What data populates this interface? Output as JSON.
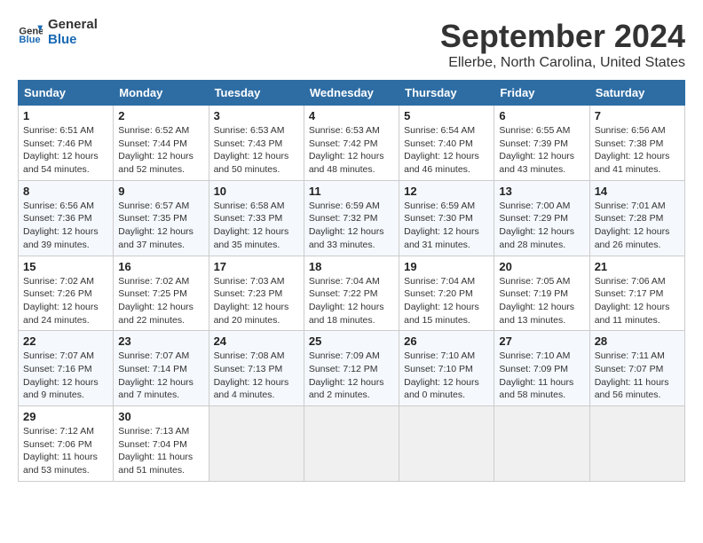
{
  "logo": {
    "line1": "General",
    "line2": "Blue"
  },
  "title": "September 2024",
  "location": "Ellerbe, North Carolina, United States",
  "days_of_week": [
    "Sunday",
    "Monday",
    "Tuesday",
    "Wednesday",
    "Thursday",
    "Friday",
    "Saturday"
  ],
  "weeks": [
    [
      {
        "day": "1",
        "sunrise": "6:51 AM",
        "sunset": "7:46 PM",
        "daylight": "12 hours and 54 minutes."
      },
      {
        "day": "2",
        "sunrise": "6:52 AM",
        "sunset": "7:44 PM",
        "daylight": "12 hours and 52 minutes."
      },
      {
        "day": "3",
        "sunrise": "6:53 AM",
        "sunset": "7:43 PM",
        "daylight": "12 hours and 50 minutes."
      },
      {
        "day": "4",
        "sunrise": "6:53 AM",
        "sunset": "7:42 PM",
        "daylight": "12 hours and 48 minutes."
      },
      {
        "day": "5",
        "sunrise": "6:54 AM",
        "sunset": "7:40 PM",
        "daylight": "12 hours and 46 minutes."
      },
      {
        "day": "6",
        "sunrise": "6:55 AM",
        "sunset": "7:39 PM",
        "daylight": "12 hours and 43 minutes."
      },
      {
        "day": "7",
        "sunrise": "6:56 AM",
        "sunset": "7:38 PM",
        "daylight": "12 hours and 41 minutes."
      }
    ],
    [
      {
        "day": "8",
        "sunrise": "6:56 AM",
        "sunset": "7:36 PM",
        "daylight": "12 hours and 39 minutes."
      },
      {
        "day": "9",
        "sunrise": "6:57 AM",
        "sunset": "7:35 PM",
        "daylight": "12 hours and 37 minutes."
      },
      {
        "day": "10",
        "sunrise": "6:58 AM",
        "sunset": "7:33 PM",
        "daylight": "12 hours and 35 minutes."
      },
      {
        "day": "11",
        "sunrise": "6:59 AM",
        "sunset": "7:32 PM",
        "daylight": "12 hours and 33 minutes."
      },
      {
        "day": "12",
        "sunrise": "6:59 AM",
        "sunset": "7:30 PM",
        "daylight": "12 hours and 31 minutes."
      },
      {
        "day": "13",
        "sunrise": "7:00 AM",
        "sunset": "7:29 PM",
        "daylight": "12 hours and 28 minutes."
      },
      {
        "day": "14",
        "sunrise": "7:01 AM",
        "sunset": "7:28 PM",
        "daylight": "12 hours and 26 minutes."
      }
    ],
    [
      {
        "day": "15",
        "sunrise": "7:02 AM",
        "sunset": "7:26 PM",
        "daylight": "12 hours and 24 minutes."
      },
      {
        "day": "16",
        "sunrise": "7:02 AM",
        "sunset": "7:25 PM",
        "daylight": "12 hours and 22 minutes."
      },
      {
        "day": "17",
        "sunrise": "7:03 AM",
        "sunset": "7:23 PM",
        "daylight": "12 hours and 20 minutes."
      },
      {
        "day": "18",
        "sunrise": "7:04 AM",
        "sunset": "7:22 PM",
        "daylight": "12 hours and 18 minutes."
      },
      {
        "day": "19",
        "sunrise": "7:04 AM",
        "sunset": "7:20 PM",
        "daylight": "12 hours and 15 minutes."
      },
      {
        "day": "20",
        "sunrise": "7:05 AM",
        "sunset": "7:19 PM",
        "daylight": "12 hours and 13 minutes."
      },
      {
        "day": "21",
        "sunrise": "7:06 AM",
        "sunset": "7:17 PM",
        "daylight": "12 hours and 11 minutes."
      }
    ],
    [
      {
        "day": "22",
        "sunrise": "7:07 AM",
        "sunset": "7:16 PM",
        "daylight": "12 hours and 9 minutes."
      },
      {
        "day": "23",
        "sunrise": "7:07 AM",
        "sunset": "7:14 PM",
        "daylight": "12 hours and 7 minutes."
      },
      {
        "day": "24",
        "sunrise": "7:08 AM",
        "sunset": "7:13 PM",
        "daylight": "12 hours and 4 minutes."
      },
      {
        "day": "25",
        "sunrise": "7:09 AM",
        "sunset": "7:12 PM",
        "daylight": "12 hours and 2 minutes."
      },
      {
        "day": "26",
        "sunrise": "7:10 AM",
        "sunset": "7:10 PM",
        "daylight": "12 hours and 0 minutes."
      },
      {
        "day": "27",
        "sunrise": "7:10 AM",
        "sunset": "7:09 PM",
        "daylight": "11 hours and 58 minutes."
      },
      {
        "day": "28",
        "sunrise": "7:11 AM",
        "sunset": "7:07 PM",
        "daylight": "11 hours and 56 minutes."
      }
    ],
    [
      {
        "day": "29",
        "sunrise": "7:12 AM",
        "sunset": "7:06 PM",
        "daylight": "11 hours and 53 minutes."
      },
      {
        "day": "30",
        "sunrise": "7:13 AM",
        "sunset": "7:04 PM",
        "daylight": "11 hours and 51 minutes."
      },
      null,
      null,
      null,
      null,
      null
    ]
  ]
}
